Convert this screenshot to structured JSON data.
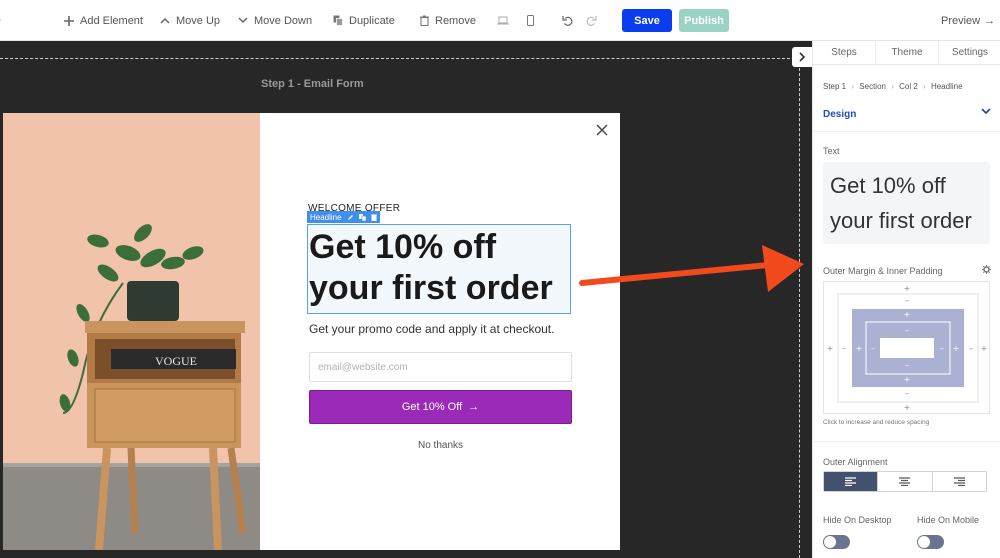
{
  "toolbar": {
    "add_element": "Add Element",
    "move_up": "Move Up",
    "move_down": "Move Down",
    "duplicate": "Duplicate",
    "remove": "Remove",
    "save": "Save",
    "publish": "Publish",
    "preview": "Preview"
  },
  "canvas": {
    "step_label": "Step 1 - Email Form"
  },
  "popup": {
    "eyebrow": "WELCOME OFFER",
    "selection_tag": "Headline",
    "headline": "Get 10% off your first order",
    "subtext": "Get your promo code and apply it at checkout.",
    "email_placeholder": "email@website.com",
    "cta_label": "Get 10% Off",
    "cta_arrow": "→",
    "decline": "No thanks",
    "book_text": "VOGUE"
  },
  "panel": {
    "tabs": [
      {
        "label": "Steps"
      },
      {
        "label": "Theme"
      },
      {
        "label": "Settings"
      }
    ],
    "breadcrumb": [
      "Step 1",
      "Section",
      "Col 2",
      "Headline"
    ],
    "design_label": "Design",
    "text_label": "Text",
    "text_value": "Get 10% off your first order",
    "spacing_label": "Outer Margin & Inner Padding",
    "spacing_hint": "Click to increase and reduce spacing",
    "alignment_label": "Outer Alignment",
    "alignment_selected": "left",
    "hide_desktop_label": "Hide On Desktop",
    "hide_mobile_label": "Hide On Mobile"
  },
  "colors": {
    "save": "#0a3cf0",
    "publish": "#9ad3c4",
    "cta": "#9b2ab8",
    "canvas_bg": "#282728",
    "annotation_arrow": "#f24a1d",
    "selection": "#3f8ff0"
  }
}
